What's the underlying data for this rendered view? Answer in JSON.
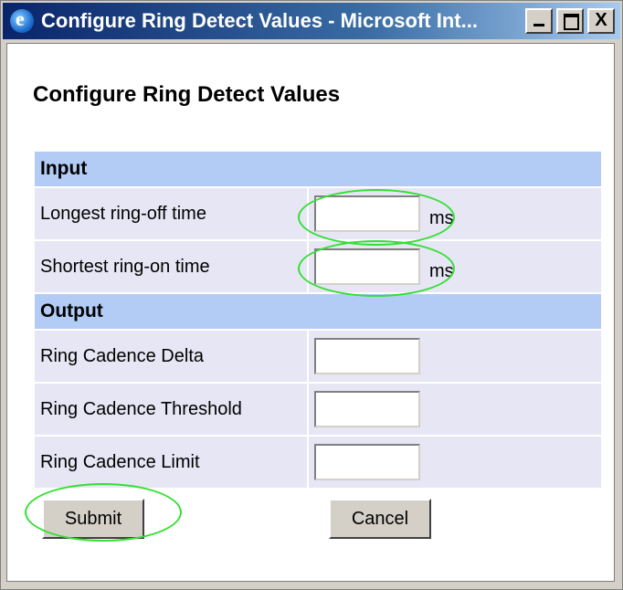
{
  "window": {
    "title": "Configure Ring Detect Values - Microsoft Int...",
    "buttons": {
      "minimize": "",
      "maximize": "",
      "close": "X"
    }
  },
  "page": {
    "heading": "Configure Ring Detect Values"
  },
  "form": {
    "input_section": {
      "title": "Input",
      "rows": [
        {
          "label": "Longest ring-off time",
          "value": "",
          "unit": "ms"
        },
        {
          "label": "Shortest ring-on time",
          "value": "",
          "unit": "ms"
        }
      ]
    },
    "output_section": {
      "title": "Output",
      "rows": [
        {
          "label": "Ring Cadence Delta",
          "value": ""
        },
        {
          "label": "Ring Cadence Threshold",
          "value": ""
        },
        {
          "label": "Ring Cadence Limit",
          "value": ""
        }
      ]
    },
    "actions": {
      "submit": "Submit",
      "cancel": "Cancel"
    }
  },
  "colors": {
    "section_header": "#b3ccf6",
    "row_background": "#e6e6f5",
    "annotation": "#33e033"
  }
}
